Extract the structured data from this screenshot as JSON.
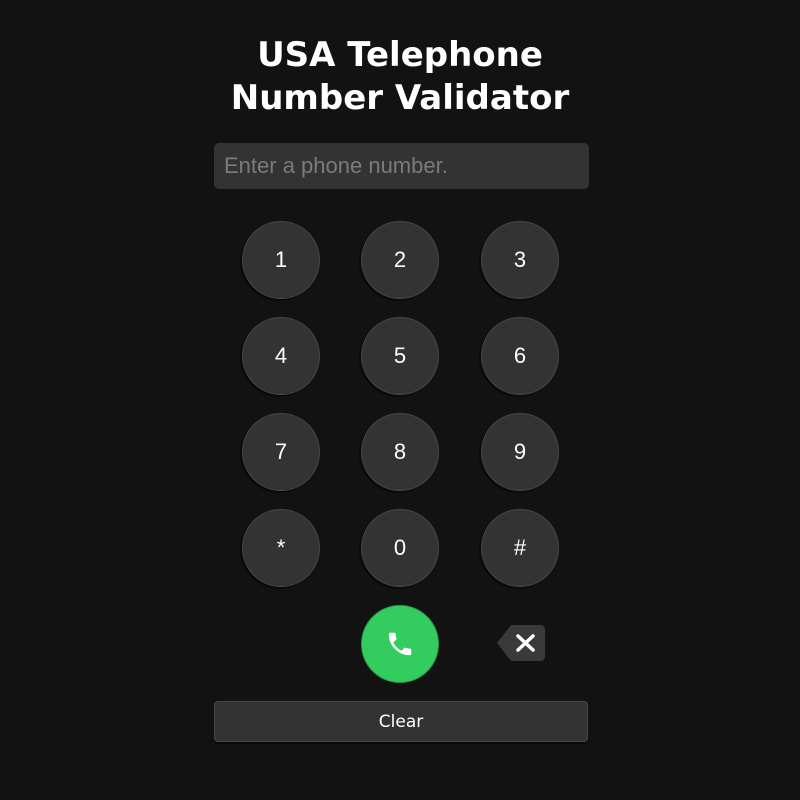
{
  "header": {
    "title_line1": "USA Telephone",
    "title_line2": "Number Validator"
  },
  "input": {
    "placeholder": "Enter a phone number.",
    "value": ""
  },
  "keypad": {
    "keys": [
      "1",
      "2",
      "3",
      "4",
      "5",
      "6",
      "7",
      "8",
      "9",
      "*",
      "0",
      "#"
    ]
  },
  "actions": {
    "call_icon": "phone-icon",
    "backspace_icon": "backspace-icon",
    "clear_label": "Clear"
  },
  "colors": {
    "background": "#121212",
    "key_background": "#333333",
    "call_green": "#33cc5e"
  }
}
